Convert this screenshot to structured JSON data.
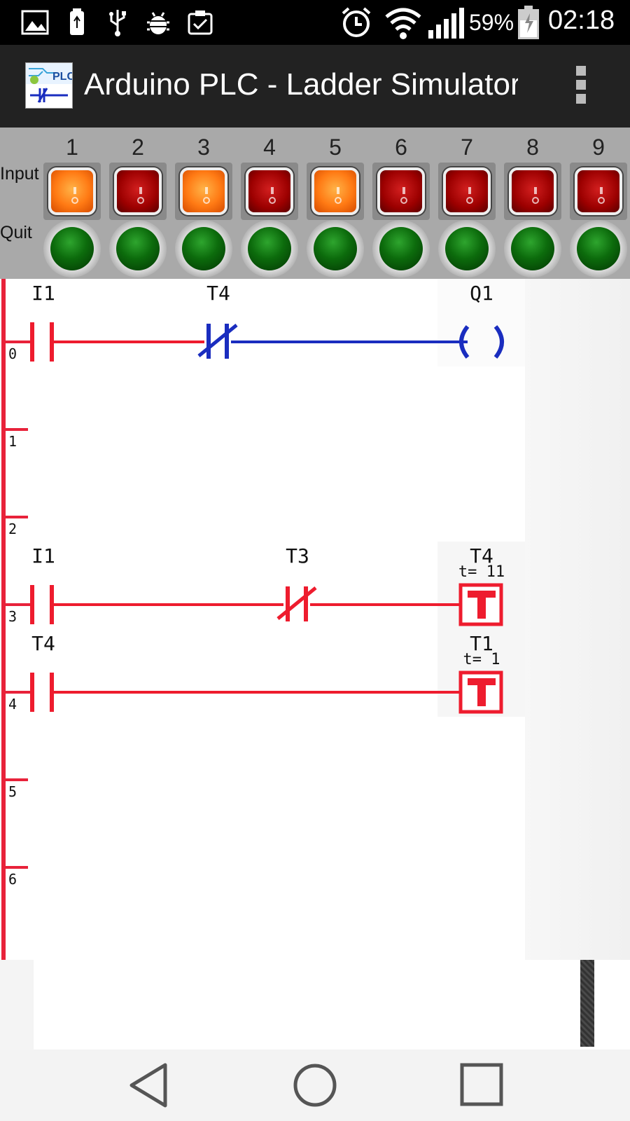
{
  "status_bar": {
    "icons": [
      "gallery-icon",
      "usb-storage-icon",
      "usb-icon",
      "android-debug-icon",
      "clipboard-check-icon",
      "alarm-icon",
      "wifi-icon",
      "signal-icon",
      "battery-charging-icon"
    ],
    "battery_percent": "59%",
    "time": "02:18"
  },
  "action_bar": {
    "title": "Arduino PLC - Ladder Simulator",
    "logo_text": "PLC",
    "menu_icon": "overflow-menu-icon"
  },
  "io_panel": {
    "input_label": "Input",
    "output_label": "Quit",
    "channels": [
      "1",
      "2",
      "3",
      "4",
      "5",
      "6",
      "7",
      "8",
      "9"
    ],
    "inputs": [
      {
        "on": true
      },
      {
        "on": false
      },
      {
        "on": true
      },
      {
        "on": false
      },
      {
        "on": true
      },
      {
        "on": false
      },
      {
        "on": false
      },
      {
        "on": false
      },
      {
        "on": false
      }
    ],
    "outputs": [
      {
        "on": true
      },
      {
        "on": true
      },
      {
        "on": true
      },
      {
        "on": true
      },
      {
        "on": true
      },
      {
        "on": true
      },
      {
        "on": true
      },
      {
        "on": true
      },
      {
        "on": true
      }
    ]
  },
  "ladder": {
    "rungs": [
      {
        "number": "0",
        "elements": [
          {
            "type": "contact-no",
            "label": "I1",
            "state": "active"
          },
          {
            "type": "contact-nc",
            "label": "T4",
            "state": "inactive"
          },
          {
            "type": "coil",
            "label": "Q1",
            "state": "inactive"
          }
        ]
      },
      {
        "number": "1",
        "elements": []
      },
      {
        "number": "2",
        "elements": []
      },
      {
        "number": "3",
        "elements": [
          {
            "type": "contact-no",
            "label": "I1",
            "state": "active"
          },
          {
            "type": "contact-nc",
            "label": "T3",
            "state": "active"
          },
          {
            "type": "timer",
            "label": "T4",
            "preset": "t=  11",
            "state": "active"
          }
        ]
      },
      {
        "number": "4",
        "elements": [
          {
            "type": "contact-no",
            "label": "T4",
            "state": "active"
          },
          {
            "type": "timer",
            "label": "T1",
            "preset": "t=  1",
            "state": "active"
          }
        ]
      },
      {
        "number": "5",
        "elements": []
      },
      {
        "number": "6",
        "elements": []
      }
    ],
    "colors": {
      "active": "#ee1c2e",
      "inactive": "#1a2dbf",
      "rail": "#e8223a"
    }
  },
  "nav_bar": {
    "back": "back-icon",
    "home": "home-icon",
    "recents": "recents-icon"
  }
}
